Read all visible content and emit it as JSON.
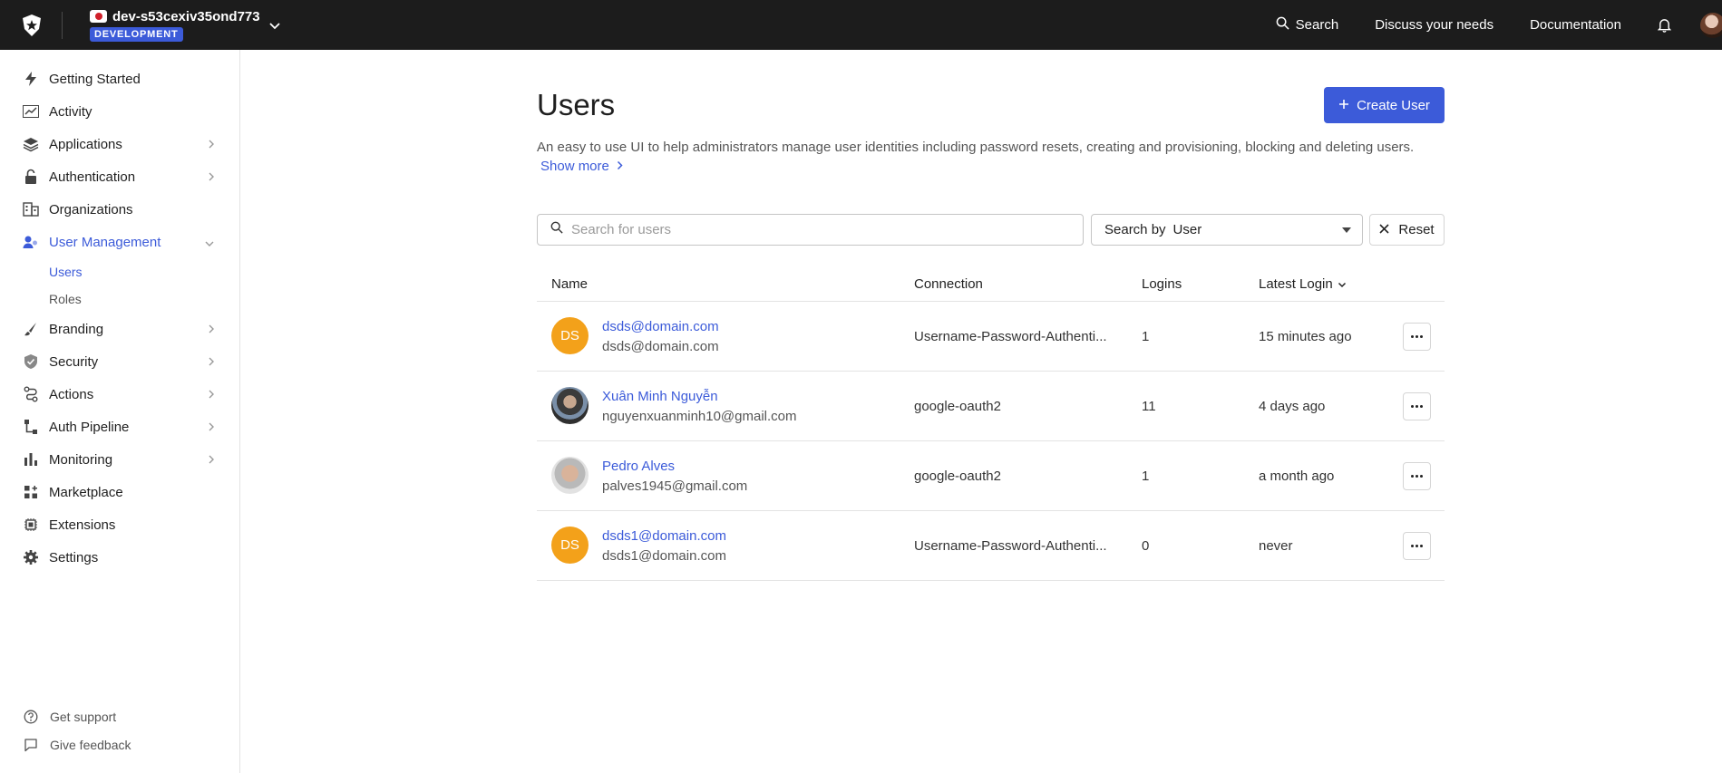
{
  "topbar": {
    "tenant_name": "dev-s53cexiv35ond773",
    "env_badge": "DEVELOPMENT",
    "search_label": "Search",
    "discuss_label": "Discuss your needs",
    "docs_label": "Documentation"
  },
  "sidebar": {
    "items": [
      {
        "label": "Getting Started",
        "icon": "bolt-icon"
      },
      {
        "label": "Activity",
        "icon": "trend-icon"
      },
      {
        "label": "Applications",
        "icon": "layers-icon"
      },
      {
        "label": "Authentication",
        "icon": "lock-icon"
      },
      {
        "label": "Organizations",
        "icon": "building-icon"
      },
      {
        "label": "User Management",
        "icon": "users-icon"
      },
      {
        "label": "Branding",
        "icon": "brush-icon"
      },
      {
        "label": "Security",
        "icon": "shield-icon"
      },
      {
        "label": "Actions",
        "icon": "flow-icon"
      },
      {
        "label": "Auth Pipeline",
        "icon": "pipeline-icon"
      },
      {
        "label": "Monitoring",
        "icon": "bars-icon"
      },
      {
        "label": "Marketplace",
        "icon": "grid-plus-icon"
      },
      {
        "label": "Extensions",
        "icon": "chip-icon"
      },
      {
        "label": "Settings",
        "icon": "gear-icon"
      }
    ],
    "sub_items": [
      "Users",
      "Roles"
    ],
    "bottom": {
      "support": "Get support",
      "feedback": "Give feedback"
    }
  },
  "main": {
    "title": "Users",
    "create_label": "Create User",
    "description": "An easy to use UI to help administrators manage user identities including password resets, creating and provisioning, blocking and deleting users.",
    "show_more": "Show more",
    "search_placeholder": "Search for users",
    "search_by_label": "Search by",
    "search_by_value": "User",
    "reset_label": "Reset",
    "table": {
      "headers": [
        "Name",
        "Connection",
        "Logins",
        "Latest Login"
      ],
      "rows": [
        {
          "initials": "DS",
          "name": "dsds@domain.com",
          "email": "dsds@domain.com",
          "connection": "Username-Password-Authenti...",
          "logins": "1",
          "latest": "15 minutes ago"
        },
        {
          "initials": "",
          "name": "Xuân Minh Nguyễn",
          "email": "nguyenxuanminh10@gmail.com",
          "connection": "google-oauth2",
          "logins": "11",
          "latest": "4 days ago"
        },
        {
          "initials": "",
          "name": "Pedro Alves",
          "email": "palves1945@gmail.com",
          "connection": "google-oauth2",
          "logins": "1",
          "latest": "a month ago"
        },
        {
          "initials": "DS",
          "name": "dsds1@domain.com",
          "email": "dsds1@domain.com",
          "connection": "Username-Password-Authenti...",
          "logins": "0",
          "latest": "never"
        }
      ]
    }
  },
  "colors": {
    "accent": "#3c5bd9",
    "topbar": "#1c1c1c",
    "avatar_initials": "#f3a11a"
  }
}
